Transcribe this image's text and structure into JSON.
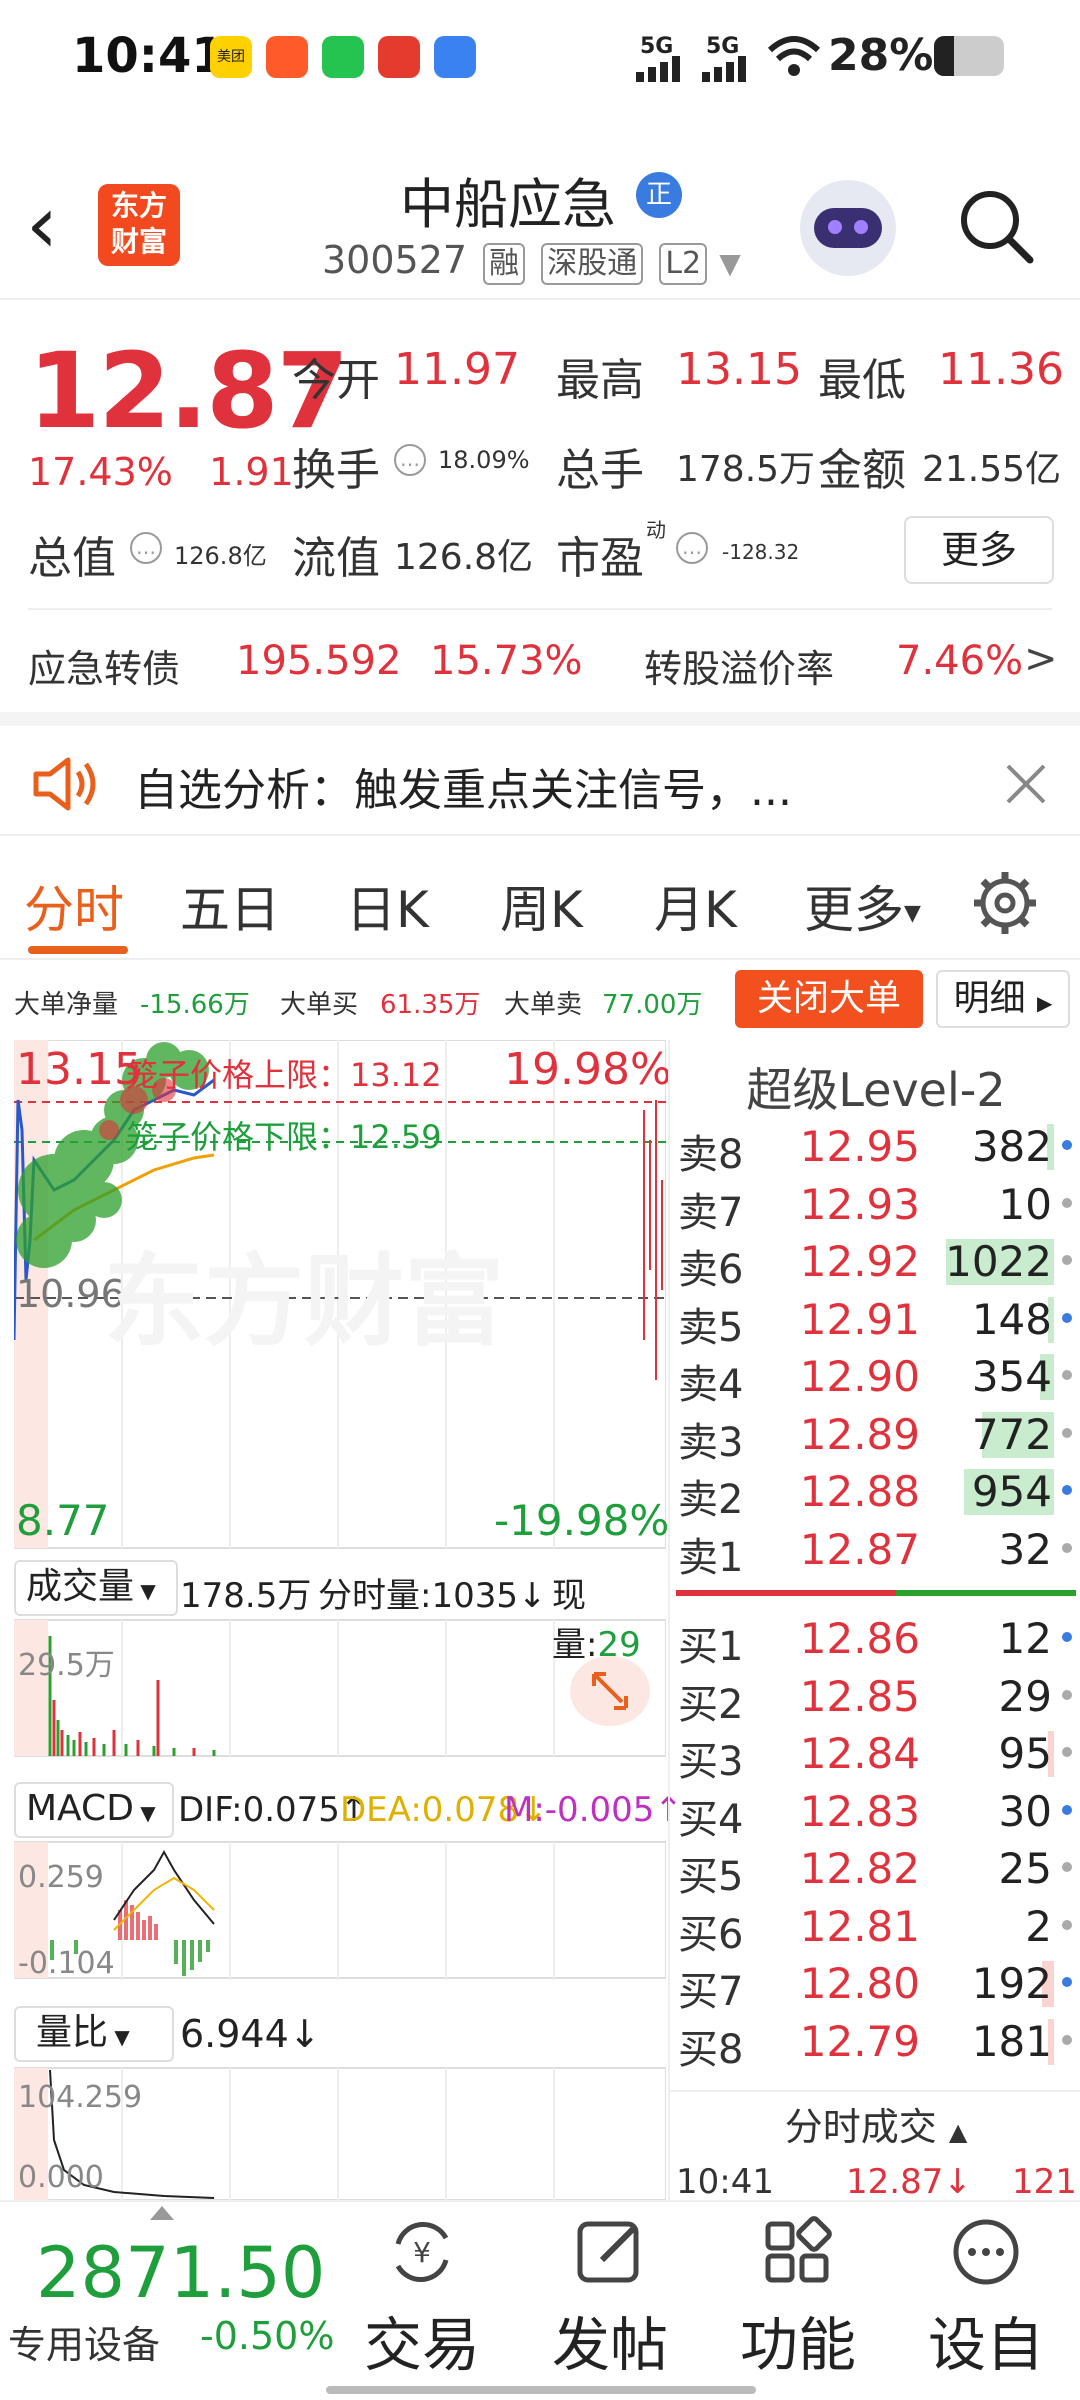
{
  "status_bar": {
    "time": "10:41",
    "network1": "5G",
    "network2": "5G",
    "battery": "28%",
    "app_icon_label": "美团"
  },
  "header": {
    "stock_name": "中船应急",
    "badge": "正",
    "code": "300527",
    "tags": [
      "融",
      "深股通",
      "L2"
    ],
    "logo_lines": [
      "东方",
      "财富"
    ]
  },
  "quote": {
    "price": "12.87",
    "change_pct": "17.43%",
    "change_abs": "1.91",
    "open_label": "今开",
    "open": "11.97",
    "high_label": "最高",
    "high": "13.15",
    "low_label": "最低",
    "low": "11.36",
    "turnover_label": "换手",
    "turnover": "18.09%",
    "volume_label": "总手",
    "volume": "178.5万",
    "amount_label": "金额",
    "amount": "21.55亿",
    "mcap_label": "总值",
    "mcap": "126.8亿",
    "float_label": "流值",
    "float": "126.8亿",
    "pe_label": "市盈",
    "pe_sup": "动",
    "pe": "-128.32",
    "more_label": "更多",
    "bond_label": "应急转债",
    "bond_price": "195.592",
    "bond_pct": "15.73%",
    "premium_label": "转股溢价率",
    "premium": "7.46%"
  },
  "notice": {
    "text": "自选分析：触发重点关注信号，..."
  },
  "tabs": [
    "分时",
    "五日",
    "日K",
    "周K",
    "月K",
    "更多"
  ],
  "bigorder": {
    "net_label": "大单净量",
    "net": "-15.66万",
    "buy_label": "大单买",
    "buy": "61.35万",
    "sell_label": "大单卖",
    "sell": "77.00万",
    "close_label": "关闭大单",
    "detail_label": "明细"
  },
  "chart": {
    "price_top": "13.15",
    "pct_top": "19.98%",
    "upper_limit": "笼子价格上限：13.12",
    "lower_limit": "笼子价格下限：12.59",
    "mid_price": "10.96",
    "price_bottom": "8.77",
    "pct_bottom": "-19.98%",
    "watermark": "东方财富",
    "vol_label": "成交量",
    "vol_total": "178.5万",
    "vol_tick_label": "分时量:1035↓",
    "vol_now_label": "现量:",
    "vol_now": "29",
    "vol_max": "29.5万",
    "macd_label": "MACD",
    "dif": "DIF:0.075↑",
    "dea": "DEA:0.078↓",
    "m": "M:-0.005↑",
    "macd_top": "0.259",
    "macd_bottom": "-0.104",
    "lb_label": "量比",
    "lb_value": "6.944↓",
    "lb_top": "104.259",
    "lb_bottom": "0.000"
  },
  "orderbook": {
    "title": "超级Level-2",
    "asks": [
      {
        "label": "卖8",
        "price": "12.95",
        "vol": "382",
        "fill": 0.06
      },
      {
        "label": "卖7",
        "price": "12.93",
        "vol": "10",
        "fill": 0.0
      },
      {
        "label": "卖6",
        "price": "12.92",
        "vol": "1022",
        "fill": 0.9
      },
      {
        "label": "卖5",
        "price": "12.91",
        "vol": "148",
        "fill": 0.05
      },
      {
        "label": "卖4",
        "price": "12.90",
        "vol": "354",
        "fill": 0.12
      },
      {
        "label": "卖3",
        "price": "12.89",
        "vol": "772",
        "fill": 0.6
      },
      {
        "label": "卖2",
        "price": "12.88",
        "vol": "954",
        "fill": 0.75
      },
      {
        "label": "卖1",
        "price": "12.87",
        "vol": "32",
        "fill": 0.0
      }
    ],
    "bids": [
      {
        "label": "买1",
        "price": "12.86",
        "vol": "12",
        "fill": 0.0
      },
      {
        "label": "买2",
        "price": "12.85",
        "vol": "29",
        "fill": 0.0
      },
      {
        "label": "买3",
        "price": "12.84",
        "vol": "95",
        "fill": 0.05
      },
      {
        "label": "买4",
        "price": "12.83",
        "vol": "30",
        "fill": 0.0
      },
      {
        "label": "买5",
        "price": "12.82",
        "vol": "25",
        "fill": 0.0
      },
      {
        "label": "买6",
        "price": "12.81",
        "vol": "2",
        "fill": 0.0
      },
      {
        "label": "买7",
        "price": "12.80",
        "vol": "192",
        "fill": 0.1
      },
      {
        "label": "买8",
        "price": "12.79",
        "vol": "181",
        "fill": 0.05
      }
    ],
    "ticks_label": "分时成交",
    "tick_time": "10:41",
    "tick_price": "12.87↓",
    "tick_vol": "121"
  },
  "bottombar": {
    "index_value": "2871.50",
    "index_name": "专用设备",
    "index_pct": "-0.50%",
    "nav": [
      "交易",
      "发帖",
      "功能",
      "设自"
    ]
  }
}
